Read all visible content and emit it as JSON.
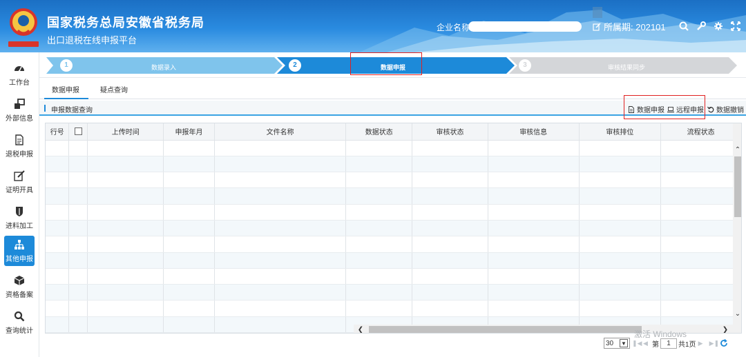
{
  "header": {
    "title": "国家税务总局安徽省税务局",
    "subtitle": "出口退税在线申报平台",
    "company_label": "企业名称",
    "period_label": "所属期: 202101"
  },
  "sidebar": {
    "items": [
      {
        "label": "工作台",
        "icon": "dashboard-icon",
        "active": false
      },
      {
        "label": "外部信息",
        "icon": "external-info-icon",
        "active": false
      },
      {
        "label": "退税申报",
        "icon": "document-icon",
        "active": false
      },
      {
        "label": "证明开具",
        "icon": "edit-icon",
        "active": false
      },
      {
        "label": "进料加工",
        "icon": "shield-icon",
        "active": false
      },
      {
        "label": "其他申报",
        "icon": "org-chart-icon",
        "active": true
      },
      {
        "label": "资格备案",
        "icon": "cube-icon",
        "active": false
      },
      {
        "label": "查询统计",
        "icon": "search-icon",
        "active": false
      }
    ]
  },
  "steps": [
    {
      "num": "1",
      "label": "数据录入",
      "state": "done"
    },
    {
      "num": "2",
      "label": "数据申报",
      "state": "current"
    },
    {
      "num": "3",
      "label": "审核结果同步",
      "state": "todo"
    }
  ],
  "tabs": [
    {
      "label": "数据申报",
      "active": true
    },
    {
      "label": "疑点查询",
      "active": false
    }
  ],
  "section": {
    "title": "申报数据查询",
    "actions": [
      {
        "label": "数据申报",
        "icon": "file-icon"
      },
      {
        "label": "远程申报",
        "icon": "laptop-icon"
      },
      {
        "label": "数据撤销",
        "icon": "undo-icon"
      }
    ]
  },
  "table": {
    "columns": [
      "行号",
      "",
      "上传时间",
      "申报年月",
      "文件名称",
      "数据状态",
      "审核状态",
      "审核信息",
      "审核排位",
      "流程状态"
    ],
    "rows": []
  },
  "watermark": "激活 Windows",
  "pagination": {
    "page_size": "30",
    "page_prefix": "第",
    "page_value": "1",
    "total": "共1页"
  },
  "colors": {
    "accent": "#1d8ad9",
    "highlight": "#e02020",
    "step_done": "#7fc4ec",
    "step_todo": "#d4d6d9"
  }
}
